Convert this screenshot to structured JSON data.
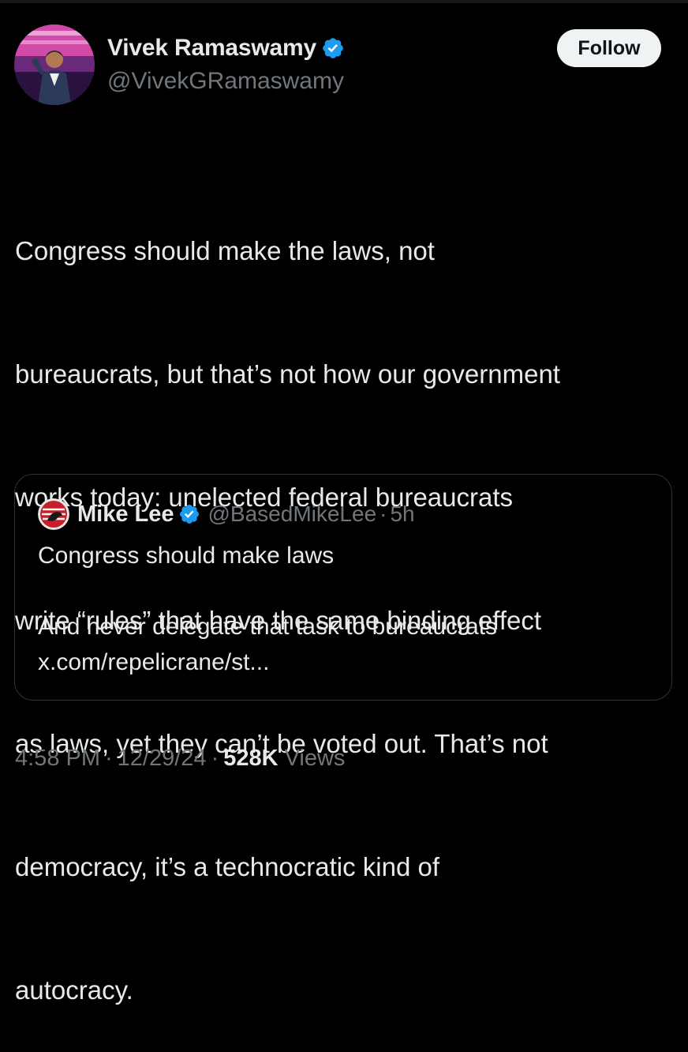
{
  "author": {
    "display_name": "Vivek Ramaswamy",
    "handle": "@VivekGRamaswamy",
    "verified_icon": "verified-badge-icon"
  },
  "follow_label": "Follow",
  "tweet": {
    "lines": [
      "Congress should make the laws, not",
      "bureaucrats, but that’s not how our government",
      "works today: unelected federal bureaucrats",
      "write “rules” that have the same binding effect",
      "as laws, yet they can’t be voted out. That’s not",
      "democracy, it’s a technocratic kind of",
      "autocracy."
    ]
  },
  "quote": {
    "display_name": "Mike Lee",
    "handle": "@BasedMikeLee",
    "separator": "·",
    "time": "5h",
    "line1": "Congress should make laws",
    "line2": "And never delegate that task to bureaucrats",
    "link": "x.com/repelicrane/st..."
  },
  "meta": {
    "time": "4:58 PM",
    "separator": "·",
    "date": "12/29/24",
    "views_count": "528K",
    "views_label": "Views"
  },
  "colors": {
    "background": "#000000",
    "text_primary": "#e7e9ea",
    "text_secondary": "#71767b",
    "verified_blue": "#1d9bf0",
    "border": "#2f3336",
    "follow_bg": "#eff3f4"
  }
}
